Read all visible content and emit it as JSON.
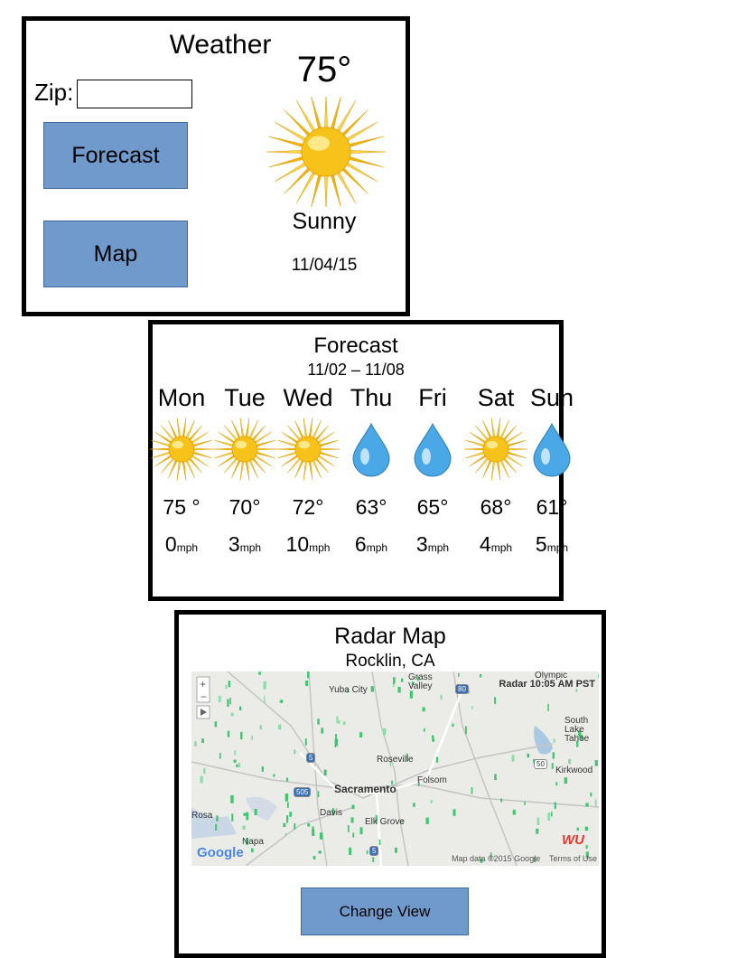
{
  "weather": {
    "title": "Weather",
    "zip_label": "Zip:",
    "zip_value": "",
    "forecast_button": "Forecast",
    "map_button": "Map",
    "temperature": "75°",
    "condition": "Sunny",
    "date": "11/04/15",
    "icon": "sun-icon"
  },
  "forecast": {
    "title": "Forecast",
    "range": "11/02 – 11/08",
    "days": [
      {
        "day": "Mon",
        "icon": "sun-icon",
        "temp": "75 °",
        "wind": "0",
        "unit": "mph"
      },
      {
        "day": "Tue",
        "icon": "sun-icon",
        "temp": "70°",
        "wind": "3",
        "unit": "mph"
      },
      {
        "day": "Wed",
        "icon": "sun-icon",
        "temp": "72°",
        "wind": "10",
        "unit": "mph"
      },
      {
        "day": "Thu",
        "icon": "raindrop-icon",
        "temp": "63°",
        "wind": "6",
        "unit": "mph"
      },
      {
        "day": "Fri",
        "icon": "raindrop-icon",
        "temp": "65°",
        "wind": "3",
        "unit": "mph"
      },
      {
        "day": "Sat",
        "icon": "sun-icon",
        "temp": "68°",
        "wind": "4",
        "unit": "mph"
      },
      {
        "day": "Sun",
        "icon": "raindrop-icon",
        "temp": "61°",
        "wind": "5",
        "unit": "mph"
      }
    ]
  },
  "radar": {
    "title": "Radar Map",
    "location": "Rocklin, CA",
    "map_label": "Radar 10:05 AM PST",
    "map_places": [
      "Grass Valley",
      "Yuba City",
      "Roseville",
      "Folsom",
      "Sacramento",
      "Davis",
      "Elk Grove",
      "Napa",
      "Rosa",
      "South Lake Tahoe",
      "Kirkwood",
      "Olympic"
    ],
    "highways": [
      "80",
      "5",
      "505",
      "50",
      "5"
    ],
    "google": "Google",
    "map_data": "Map data ©2015 Google",
    "terms": "Terms of Use",
    "wu": "WU",
    "change_view_button": "Change View"
  },
  "colors": {
    "button": "#6f9acb",
    "sun": "#f7c31a",
    "drop": "#4aa8e6"
  }
}
